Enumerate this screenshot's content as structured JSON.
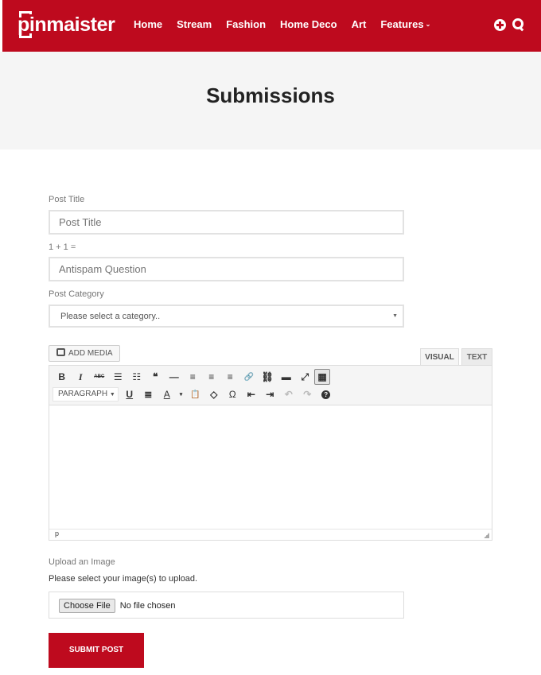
{
  "header": {
    "logo": "pinmaister",
    "nav": [
      "Home",
      "Stream",
      "Fashion",
      "Home Deco",
      "Art",
      "Features"
    ],
    "icons": [
      "plus-circle-icon",
      "search-icon"
    ],
    "brand_color": "#be0a1e"
  },
  "page": {
    "title": "Submissions"
  },
  "form": {
    "post_title": {
      "label": "Post Title",
      "placeholder": "Post Title"
    },
    "antispam": {
      "label": "1 + 1 =",
      "placeholder": "Antispam Question"
    },
    "category": {
      "label": "Post Category",
      "selected": "Please select a category.."
    },
    "editor": {
      "add_media": "ADD MEDIA",
      "tabs": [
        "VISUAL",
        "TEXT"
      ],
      "toolbar_row1": [
        "B",
        "I",
        "ABC",
        "☰",
        "☷",
        "❝",
        "—",
        "≡",
        "≡",
        "≡",
        "🔗",
        "⛓",
        "▬",
        "⤢",
        "▦"
      ],
      "toolbar_row2": [
        "U",
        "≣",
        "A",
        "▾",
        "📋",
        "◇",
        "Ω",
        "⇤",
        "⇥",
        "↶",
        "↷",
        "?"
      ],
      "format_select": "PARAGRAPH",
      "status_path": "p"
    },
    "upload": {
      "label": "Upload an Image",
      "help": "Please select your image(s) to upload.",
      "button": "Choose File",
      "status": "No file chosen"
    },
    "submit": "SUBMIT POST"
  }
}
